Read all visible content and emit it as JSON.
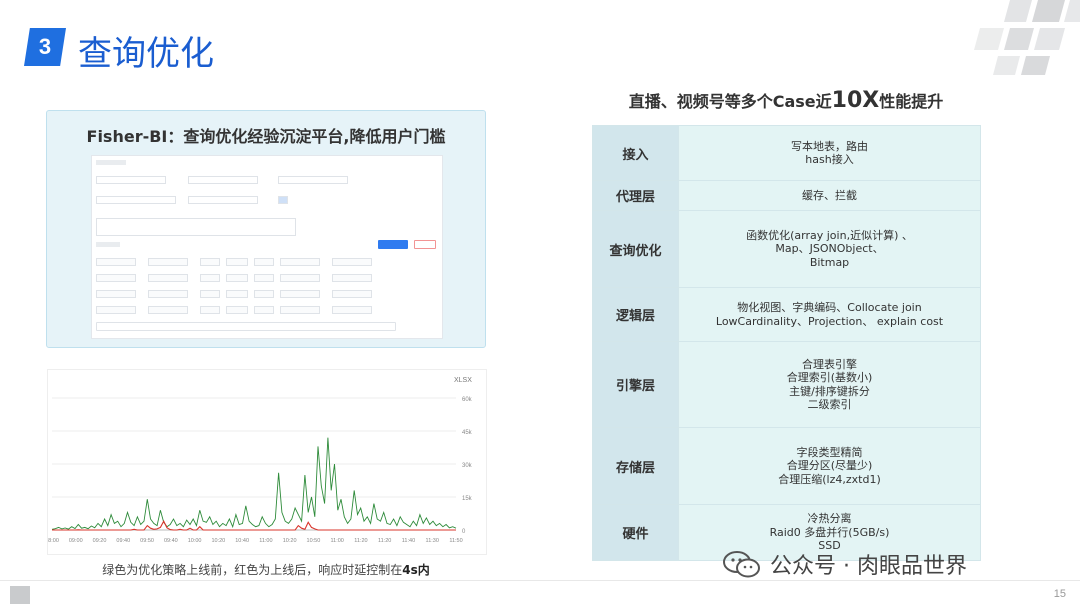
{
  "header": {
    "section_number": "3",
    "title": "查询优化"
  },
  "left_card": {
    "title": "Fisher-BI：查询优化经验沉淀平台,降低用户门槛"
  },
  "chart": {
    "caption_prefix": "绿色为优化策略上线前，红色为上线后，响应时延控制在",
    "caption_bold": "4s内",
    "export_label": "XLSX",
    "colors": {
      "before": "#2e8b3a",
      "after": "#d9342b"
    }
  },
  "chart_data": {
    "type": "line",
    "x_ticks": [
      "08:00",
      "09:00",
      "09:20",
      "09:40",
      "09:50",
      "09:40",
      "10:00",
      "10:20",
      "10:40",
      "11:00",
      "10:20",
      "10:50",
      "11:00",
      "11:20",
      "11:20",
      "11:40",
      "11:30",
      "11:50"
    ],
    "y_ticks": [
      "60k",
      "45k",
      "30k",
      "15k",
      "0"
    ],
    "ylim": [
      0,
      60000
    ],
    "series": [
      {
        "values": [
          300,
          600,
          1200,
          500,
          900,
          400,
          1500,
          700,
          2500,
          800,
          1200,
          600,
          1800,
          1000,
          3000,
          1500,
          5000,
          2000,
          7000,
          3000,
          4000,
          1500,
          3000,
          8000,
          3500,
          2000,
          6000,
          2500,
          4000,
          14000,
          5000,
          3000,
          2000,
          9000,
          3500,
          1500,
          2500,
          5000,
          2000,
          3000,
          1500,
          4500,
          2500,
          5000,
          2000,
          9000,
          4000,
          3500,
          6000,
          2500,
          4000,
          1500,
          3000,
          2000,
          5000,
          1500,
          7000,
          2500,
          3000,
          11000,
          4000,
          2500,
          1500,
          2000,
          6000,
          3000,
          1500,
          2500,
          5000,
          26000,
          8000,
          4000,
          3000,
          5000,
          10000,
          7000,
          4000,
          25000,
          8000,
          15000,
          6000,
          38000,
          20000,
          12000,
          42000,
          18000,
          30000,
          9000,
          14000,
          6000,
          3000,
          5000,
          18000,
          7000,
          10000,
          4000,
          6000,
          3000,
          12000,
          5000,
          4000,
          8000,
          3000,
          2500,
          5000,
          2000,
          6000,
          3500,
          2500,
          1500,
          4000,
          2000,
          7000,
          3000,
          5500,
          2500,
          4000,
          2000,
          3000,
          1500,
          2500,
          1000,
          1500,
          800
        ]
      },
      {
        "values": [
          0,
          0,
          0,
          0,
          0,
          0,
          0,
          0,
          100,
          0,
          0,
          0,
          0,
          0,
          0,
          0,
          0,
          0,
          0,
          0,
          0,
          0,
          0,
          0,
          0,
          300,
          0,
          0,
          0,
          2000,
          800,
          300,
          500,
          1200,
          4000,
          1000,
          200,
          0,
          0,
          300,
          0,
          0,
          800,
          0,
          0,
          1500,
          0,
          0,
          0,
          0,
          0,
          0,
          0,
          0,
          0,
          0,
          0,
          0,
          0,
          0,
          0,
          0,
          0,
          0,
          0,
          0,
          0,
          0,
          0,
          0,
          0,
          0,
          0,
          0,
          0,
          2000,
          800,
          300,
          3500,
          1200,
          500,
          0,
          0,
          0,
          0,
          0,
          0,
          0,
          0,
          0,
          0,
          0,
          0,
          0,
          0,
          0,
          0,
          0,
          0,
          0,
          0,
          0,
          0,
          0,
          0,
          0,
          0,
          0,
          0,
          0,
          0,
          0,
          0,
          0,
          0,
          0,
          0,
          0,
          0,
          0,
          0,
          0,
          0,
          0
        ]
      }
    ]
  },
  "right": {
    "title_pre": "直播、视频号等多个Case近",
    "title_big": "10X",
    "title_post": "性能提升",
    "layers": [
      {
        "name": "接入",
        "lines": [
          "写本地表，路由",
          "hash接入"
        ]
      },
      {
        "name": "代理层",
        "lines": [
          "缓存、拦截"
        ]
      },
      {
        "name": "查询优化",
        "lines": [
          "函数优化(array join,近似计算) 、",
          "Map、JSONObject、",
          "Bitmap"
        ]
      },
      {
        "name": "逻辑层",
        "lines": [
          "物化视图、字典编码、Collocate join",
          "LowCardinality、Projection、 explain cost"
        ]
      },
      {
        "name": "引擎层",
        "lines": [
          "合理表引擎",
          "合理索引(基数小)",
          "主键/排序键拆分",
          "二级索引"
        ]
      },
      {
        "name": "存储层",
        "lines": [
          "字段类型精简",
          "合理分区(尽量少)",
          "合理压缩(lz4,zxtd1)"
        ]
      },
      {
        "name": "硬件",
        "lines": [
          "冷热分离",
          "Raid0 多盘并行(5GB/s)",
          "SSD"
        ]
      }
    ]
  },
  "footer": {
    "watermark": "公众号 · 肉眼品世界",
    "page_number": "15"
  }
}
